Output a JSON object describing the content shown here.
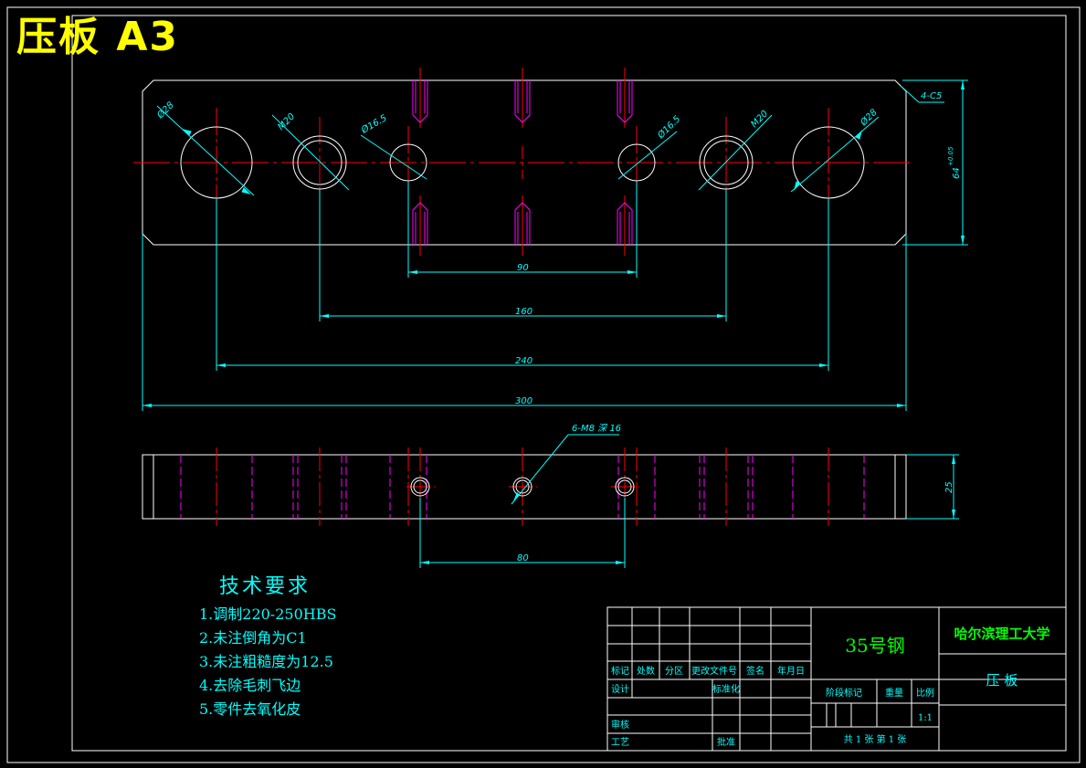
{
  "title": "压板 A3",
  "dims": {
    "d28": "Ø28",
    "m20": "M20",
    "d16_5": "Ø16.5",
    "chamfer": "4-C5",
    "height": "64",
    "height_tol": "+0.05",
    "d90": "90",
    "d160": "160",
    "d240": "240",
    "d300": "300",
    "threads": "6-M8 深 16",
    "d80": "80",
    "thickness": "25"
  },
  "tech_req": {
    "title": "技术要求",
    "items": [
      "1.调制220-250HBS",
      "2.未注倒角为C1",
      "3.未注粗糙度为12.5",
      "4.去除毛刺飞边",
      "5.零件去氧化皮"
    ]
  },
  "title_block": {
    "material": "35号钢",
    "school": "哈尔滨理工大学",
    "part_name": "压 板",
    "mark": "标记",
    "count": "处数",
    "zone": "分区",
    "change_doc": "更改文件号",
    "sign": "签名",
    "date": "年月日",
    "design": "设计",
    "std": "标准化",
    "stage": "阶段标记",
    "weight": "重量",
    "scale": "比例",
    "scale_val": "1:1",
    "review": "审核",
    "process": "工艺",
    "approve": "批准",
    "sheets": "共 1 张  第 1 张"
  },
  "colors": {
    "outline": "#ffffff",
    "center": "#ff0000",
    "thread": "#ff00ff",
    "dimension": "#00ffff",
    "material": "#00ff00",
    "title": "#ffff00"
  }
}
